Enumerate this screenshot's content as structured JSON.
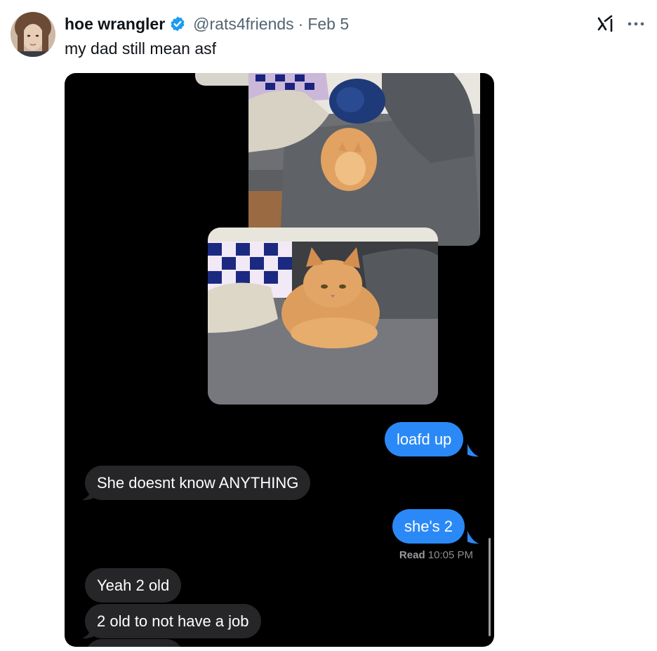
{
  "tweet": {
    "display_name": "hoe wrangler",
    "handle": "@rats4friends",
    "separator": "·",
    "date": "Feb 5",
    "text": "my dad still mean asf",
    "avatar_icon": "profile-photo",
    "verified_icon": "verified-badge-icon",
    "accent_color": "#1d9bf0"
  },
  "actions": {
    "grok_icon": "grok-icon",
    "more_icon": "more-options-icon"
  },
  "conversation": {
    "photos": [
      {
        "description_icon": "cat-photo-couch-wide"
      },
      {
        "description_icon": "cat-photo-couch-closeup"
      }
    ],
    "messages": [
      {
        "direction": "outgoing",
        "text": "loafd up"
      },
      {
        "direction": "incoming",
        "text": "She doesnt know ANYTHING"
      },
      {
        "direction": "outgoing",
        "text": "she's 2"
      },
      {
        "direction": "incoming",
        "text": "Yeah 2 old"
      },
      {
        "direction": "incoming",
        "text": "2 old to not have a job"
      }
    ],
    "read_receipt": {
      "label": "Read",
      "time": "10:05 PM"
    },
    "colors": {
      "outgoing": "#2b89f7",
      "incoming": "#262628",
      "background": "#000000"
    }
  }
}
